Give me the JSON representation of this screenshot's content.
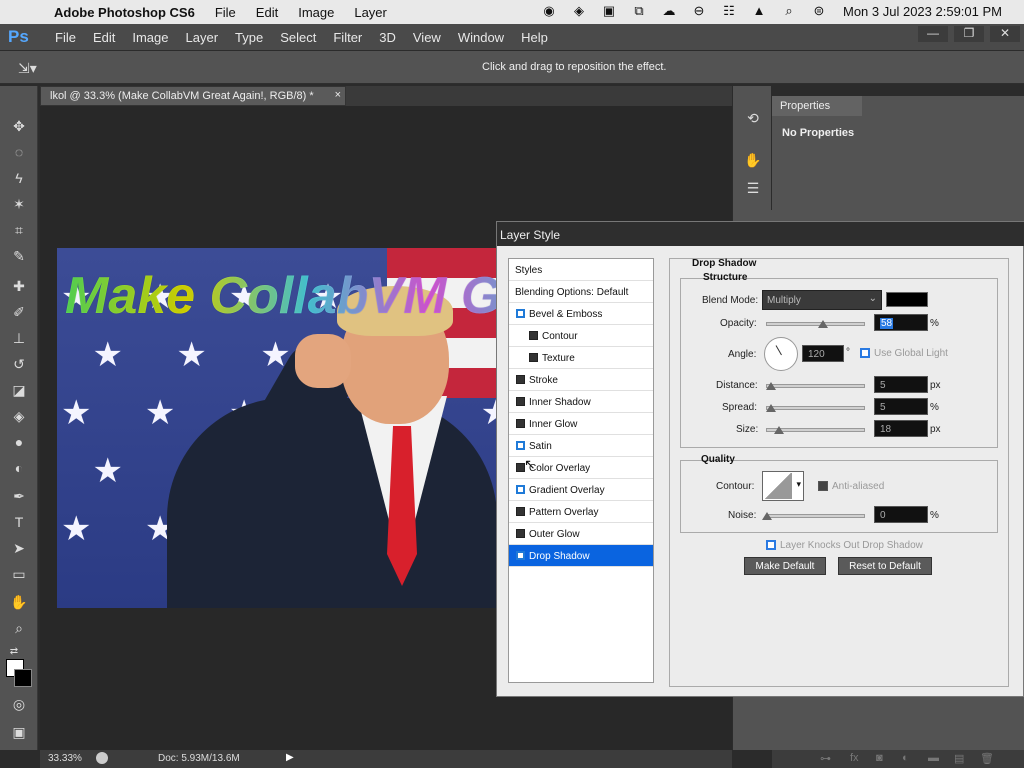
{
  "menubar": {
    "apple_icon": "apple-icon",
    "app_name": "Adobe Photoshop CS6",
    "items": [
      "File",
      "Edit",
      "Image",
      "Layer"
    ],
    "tray_icons": [
      "status-icon-1",
      "status-icon-2",
      "status-icon-3",
      "status-icon-4",
      "status-icon-5",
      "status-icon-6",
      "status-icon-7",
      "airdrop-icon",
      "search-icon",
      "control-center-icon"
    ],
    "clock": "Mon 3 Jul 2023  2:59:01 PM"
  },
  "ps_menu": {
    "logo": "Ps",
    "items": [
      "File",
      "Edit",
      "Image",
      "Layer",
      "Type",
      "Select",
      "Filter",
      "3D",
      "View",
      "Window",
      "Help"
    ],
    "window_controls": [
      "—",
      "❐",
      "✕"
    ]
  },
  "options_bar": {
    "tool_icon": "move-tool-icon",
    "hint": "Click and drag to reposition the effect."
  },
  "document": {
    "tab_title": "lkol @ 33.3% (Make CollabVM Great Again!, RGB/8) *",
    "close": "×",
    "image_text": "Make CollabVM Gre"
  },
  "status": {
    "zoom": "33.33%",
    "doc": "Doc: 5.93M/13.6M"
  },
  "properties": {
    "tab": "Properties",
    "message": "No Properties"
  },
  "dialog": {
    "title": "Layer Style",
    "styles_header": "Styles",
    "blending_options": "Blending Options: Default",
    "effects": [
      {
        "label": "Bevel & Emboss",
        "checked": true,
        "sub": false
      },
      {
        "label": "Contour",
        "checked": false,
        "sub": true
      },
      {
        "label": "Texture",
        "checked": false,
        "sub": true
      },
      {
        "label": "Stroke",
        "checked": false,
        "sub": false
      },
      {
        "label": "Inner Shadow",
        "checked": false,
        "sub": false
      },
      {
        "label": "Inner Glow",
        "checked": false,
        "sub": false
      },
      {
        "label": "Satin",
        "checked": true,
        "sub": false
      },
      {
        "label": "Color Overlay",
        "checked": false,
        "sub": false
      },
      {
        "label": "Gradient Overlay",
        "checked": true,
        "sub": false
      },
      {
        "label": "Pattern Overlay",
        "checked": false,
        "sub": false
      },
      {
        "label": "Outer Glow",
        "checked": false,
        "sub": false
      },
      {
        "label": "Drop Shadow",
        "checked": true,
        "sub": false,
        "selected": true
      }
    ],
    "drop_shadow": {
      "section_title": "Drop Shadow",
      "structure_title": "Structure",
      "blend_mode_label": "Blend Mode:",
      "blend_mode_value": "Multiply",
      "shadow_color": "#000000",
      "opacity_label": "Opacity:",
      "opacity_value": "58",
      "opacity_unit": "%",
      "opacity_fraction": 0.58,
      "angle_label": "Angle:",
      "angle_value": "120",
      "angle_unit": "°",
      "use_global_light": "Use Global Light",
      "distance_label": "Distance:",
      "distance_value": "5",
      "distance_unit": "px",
      "spread_label": "Spread:",
      "spread_value": "5",
      "spread_unit": "%",
      "size_label": "Size:",
      "size_value": "18",
      "size_unit": "px",
      "quality_title": "Quality",
      "contour_label": "Contour:",
      "anti_aliased": "Anti-aliased",
      "noise_label": "Noise:",
      "noise_value": "0",
      "noise_unit": "%",
      "knockout": "Layer Knocks Out Drop Shadow",
      "make_default": "Make Default",
      "reset_default": "Reset to Default"
    }
  }
}
